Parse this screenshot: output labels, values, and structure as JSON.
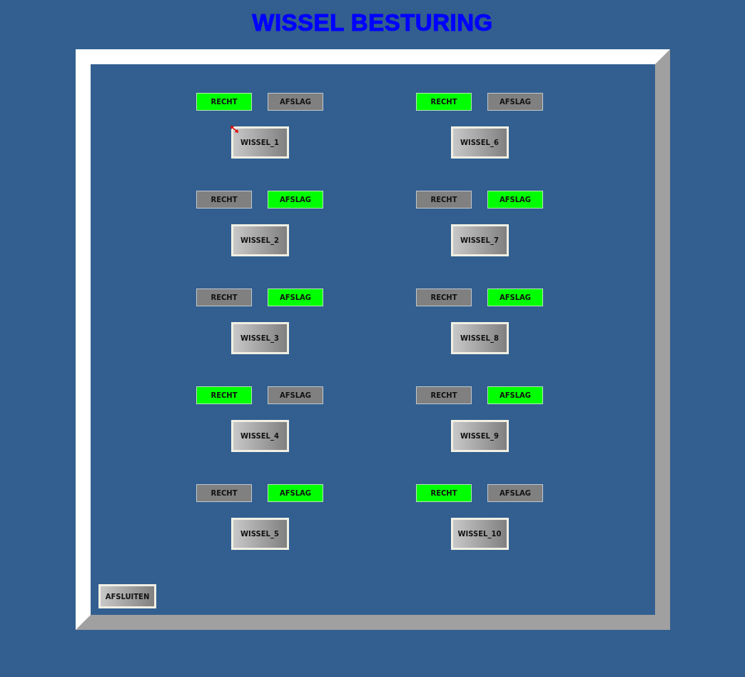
{
  "title": "WISSEL BESTURING",
  "columns": [
    {
      "switches": [
        {
          "indicators": [
            {
              "label": "RECHT",
              "on": true
            },
            {
              "label": "AFSLAG",
              "on": false
            }
          ],
          "button": "WISSEL_1",
          "flagged": true
        },
        {
          "indicators": [
            {
              "label": "RECHT",
              "on": false
            },
            {
              "label": "AFSLAG",
              "on": true
            }
          ],
          "button": "WISSEL_2",
          "flagged": false
        },
        {
          "indicators": [
            {
              "label": "RECHT",
              "on": false
            },
            {
              "label": "AFSLAG",
              "on": true
            }
          ],
          "button": "WISSEL_3",
          "flagged": false
        },
        {
          "indicators": [
            {
              "label": "RECHT",
              "on": true
            },
            {
              "label": "AFSLAG",
              "on": false
            }
          ],
          "button": "WISSEL_4",
          "flagged": false
        },
        {
          "indicators": [
            {
              "label": "RECHT",
              "on": false
            },
            {
              "label": "AFSLAG",
              "on": true
            }
          ],
          "button": "WISSEL_5",
          "flagged": false
        }
      ]
    },
    {
      "switches": [
        {
          "indicators": [
            {
              "label": "RECHT",
              "on": true
            },
            {
              "label": "AFSLAG",
              "on": false
            }
          ],
          "button": "WISSEL_6",
          "flagged": false
        },
        {
          "indicators": [
            {
              "label": "RECHT",
              "on": false
            },
            {
              "label": "AFSLAG",
              "on": true
            }
          ],
          "button": "WISSEL_7",
          "flagged": false
        },
        {
          "indicators": [
            {
              "label": "RECHT",
              "on": false
            },
            {
              "label": "AFSLAG",
              "on": true
            }
          ],
          "button": "WISSEL_8",
          "flagged": false
        },
        {
          "indicators": [
            {
              "label": "RECHT",
              "on": false
            },
            {
              "label": "AFSLAG",
              "on": true
            }
          ],
          "button": "WISSEL_9",
          "flagged": false
        },
        {
          "indicators": [
            {
              "label": "RECHT",
              "on": true
            },
            {
              "label": "AFSLAG",
              "on": false
            }
          ],
          "button": "WISSEL_10",
          "flagged": false
        }
      ]
    }
  ],
  "exit_button": "AFSLUITEN"
}
